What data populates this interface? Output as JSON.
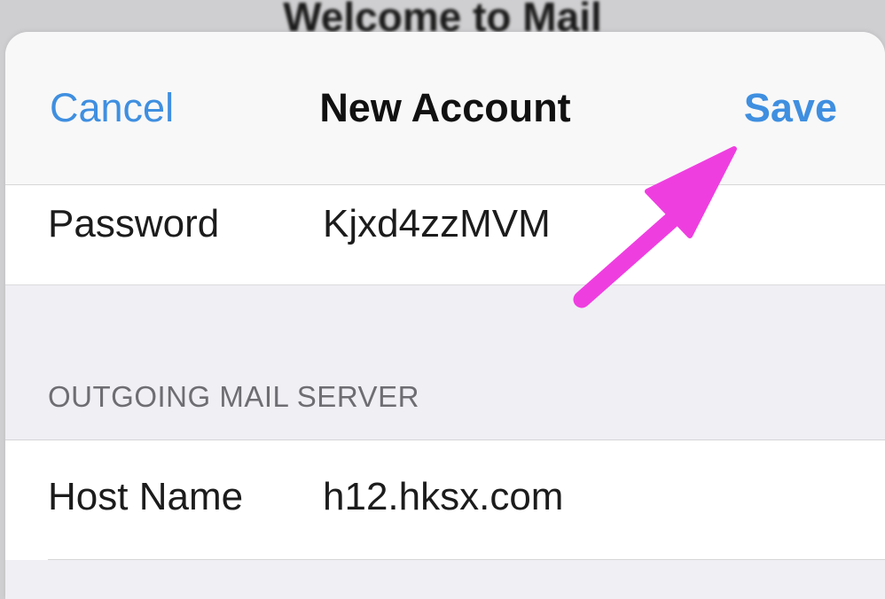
{
  "backdrop": {
    "title": "Welcome to Mail"
  },
  "nav": {
    "cancel_label": "Cancel",
    "title": "New Account",
    "save_label": "Save"
  },
  "password_row": {
    "label": "Password",
    "value": "Kjxd4zzMVM"
  },
  "outgoing_section": {
    "header": "OUTGOING MAIL SERVER"
  },
  "host_row": {
    "label": "Host Name",
    "value": "h12.hksx.com"
  },
  "colors": {
    "accent": "#3f8fe0",
    "annotation_arrow": "#ef3ee0",
    "grouped_background": "#efeff4"
  },
  "annotation": {
    "icon": "arrow-pointing-at-save"
  }
}
